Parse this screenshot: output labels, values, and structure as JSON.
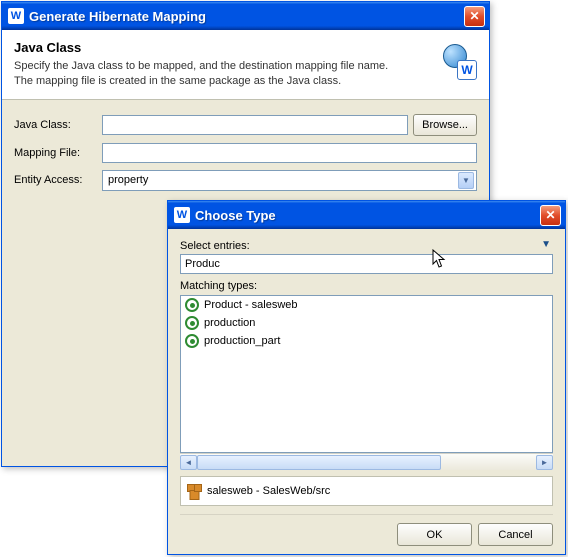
{
  "parent": {
    "title": "Generate Hibernate Mapping",
    "heading": "Java Class",
    "description1": "Specify the Java class to be mapped, and the destination mapping file name.",
    "description2": "The mapping file is created in the same package as the Java class.",
    "labels": {
      "javaClass": "Java Class:",
      "mappingFile": "Mapping File:",
      "entityAccess": "Entity Access:"
    },
    "fields": {
      "javaClass": "",
      "mappingFile": "",
      "entityAccess": "property"
    },
    "browseLabel": "Browse..."
  },
  "child": {
    "title": "Choose Type",
    "selectLabel": "Select entries:",
    "searchValue": "Produc",
    "matchingLabel": "Matching types:",
    "results": [
      "Product - salesweb",
      "production",
      "production_part"
    ],
    "info": "salesweb - SalesWeb/src",
    "okLabel": "OK",
    "cancelLabel": "Cancel"
  },
  "icons": {
    "w": "W"
  }
}
